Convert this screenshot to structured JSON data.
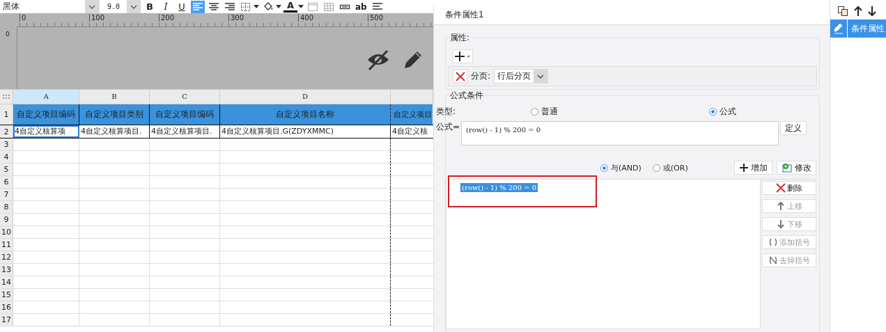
{
  "toolbar": {
    "font": "黑体",
    "size": "9.0",
    "buttons": [
      {
        "kind": "bold",
        "label": "B",
        "selected": false
      },
      {
        "kind": "italic",
        "label": "I",
        "selected": false
      },
      {
        "kind": "underline",
        "label": "U",
        "selected": false
      },
      {
        "kind": "align-left",
        "selected": true
      },
      {
        "kind": "align-center",
        "selected": false
      },
      {
        "kind": "align-right",
        "selected": false
      },
      {
        "kind": "borders",
        "selected": false
      },
      {
        "kind": "fill",
        "selected": false
      },
      {
        "kind": "font-color",
        "label": "A",
        "selected": false
      },
      {
        "kind": "merge",
        "selected": false
      },
      {
        "kind": "grid",
        "selected": false
      },
      {
        "kind": "field",
        "selected": false
      },
      {
        "kind": "text",
        "label": "ab",
        "selected": false
      },
      {
        "kind": "paragraph",
        "selected": false
      }
    ]
  },
  "ruler": {
    "marks": [
      "0",
      "100",
      "200",
      "300",
      "400",
      "500"
    ],
    "vertical_mark": "0"
  },
  "sheet": {
    "columns": [
      {
        "label": "A",
        "selected": true
      },
      {
        "label": "B",
        "selected": false
      },
      {
        "label": "C",
        "selected": false
      },
      {
        "label": "D",
        "selected": false
      },
      {
        "selected": false
      }
    ],
    "rows": [
      {
        "number": "1",
        "kind": "header",
        "cells": [
          {
            "text": "自定义项目编码",
            "selected": false
          },
          {
            "text": "自定义项目类别",
            "selected": false
          },
          {
            "text": "自定义项目编码",
            "selected": false
          },
          {
            "text": "自定义项目名称",
            "selected": false
          },
          {
            "text": "自定义项目",
            "selected": false
          }
        ]
      },
      {
        "number": "2",
        "kind": "data",
        "cells": [
          {
            "text": "4自定义核算项",
            "selected": true
          },
          {
            "text": "4自定义核算项目.",
            "selected": false
          },
          {
            "text": "4自定义核算项目.",
            "selected": false
          },
          {
            "text": "4自定义核算项目.G(ZDYXMMC)",
            "selected": false
          },
          {
            "text": "4自定义核",
            "selected": false
          }
        ]
      },
      {
        "number": "3",
        "kind": "empty"
      },
      {
        "number": "4",
        "kind": "empty"
      },
      {
        "number": "5",
        "kind": "empty"
      },
      {
        "number": "6",
        "kind": "empty"
      },
      {
        "number": "7",
        "kind": "empty"
      },
      {
        "number": "8",
        "kind": "empty"
      },
      {
        "number": "9",
        "kind": "empty"
      },
      {
        "number": "10",
        "kind": "empty"
      },
      {
        "number": "11",
        "kind": "empty"
      },
      {
        "number": "12",
        "kind": "empty"
      },
      {
        "number": "13",
        "kind": "empty"
      },
      {
        "number": "14",
        "kind": "empty"
      },
      {
        "number": "15",
        "kind": "empty"
      },
      {
        "number": "16",
        "kind": "empty"
      },
      {
        "number": "17",
        "kind": "empty"
      }
    ]
  },
  "dialog": {
    "title": "条件属性1",
    "properties": {
      "title": "属性:",
      "page_break": {
        "label": "分页:",
        "value": "行后分页"
      }
    },
    "formula_condition": {
      "title": "公式条件",
      "type_label": "类型:",
      "types": [
        {
          "label": "普通",
          "selected": false
        },
        {
          "label": "公式",
          "selected": true
        }
      ],
      "formula_label": "公式=",
      "formula": "(row() - 1) % 200 = 0",
      "define_button": "定义",
      "logic": [
        {
          "label": "与(AND)",
          "selected": true
        },
        {
          "label": "或(OR)",
          "selected": false
        }
      ],
      "add_button": "增加",
      "modify_button": "修改",
      "conditions": [
        {
          "text": "(row() - 1) % 200 = 0",
          "selected": true,
          "highlighted": true
        }
      ],
      "side_buttons": [
        {
          "kind": "delete",
          "label": "删除",
          "disabled": false
        },
        {
          "kind": "up",
          "label": "上移",
          "disabled": true
        },
        {
          "kind": "down",
          "label": "下移",
          "disabled": true
        },
        {
          "kind": "add-bracket",
          "label": "添加括号",
          "disabled": true
        },
        {
          "kind": "remove-bracket",
          "label": "去掉括号",
          "disabled": true
        }
      ]
    }
  },
  "side_panel": {
    "items": [
      {
        "label": "条件属性",
        "selected": true
      }
    ]
  }
}
